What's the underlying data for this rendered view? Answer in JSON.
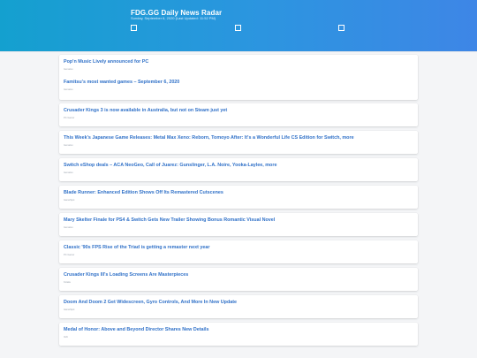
{
  "header": {
    "title": "FDG.GG Daily News Radar",
    "subtitle": "Sunday, September 6, 2020 (Last Updated: 11:52 PM)",
    "icons": [
      "checkbox-icon",
      "checkbox-icon",
      "checkbox-icon"
    ]
  },
  "articles": [
    {
      "title": "Pop'n Music Lively announced for PC",
      "source": "Gematsu"
    },
    {
      "title": "Famitsu's most wanted games – September 6, 2020",
      "source": "Gematsu"
    },
    {
      "title": "Crusader Kings 3 is now available in Australia, but not on Steam just yet",
      "source": "PC Gamer"
    },
    {
      "title": "This Week's Japanese Game Releases: Metal Max Xeno: Reborn, Tomoyo After: It's a Wonderful Life CS Edition for Switch, more",
      "source": "Gematsu"
    },
    {
      "title": "Switch eShop deals – ACA NeoGeo, Call of Juarez: Gunslinger, L.A. Noire, Yooka-Laylee, more",
      "source": "Gematsu"
    },
    {
      "title": "Blade Runner: Enhanced Edition Shows Off Its Remastered Cutscenes",
      "source": "GameSpot"
    },
    {
      "title": "Mary Skelter Finale for PS4 & Switch Gets New Trailer Showing Bonus Romantic Visual Novel",
      "source": "Gematsu"
    },
    {
      "title": "Classic '90s FPS Rise of the Triad is getting a remaster next year",
      "source": "PC Gamer"
    },
    {
      "title": "Crusader Kings III's Loading Screens Are Masterpieces",
      "source": "Kotaku"
    },
    {
      "title": "Doom And Doom 2 Get Widescreen, Gyro Controls, And More In New Update",
      "source": "GameSpot"
    },
    {
      "title": "Medal of Honor: Above and Beyond Director Shares New Details",
      "source": "IGN"
    }
  ]
}
